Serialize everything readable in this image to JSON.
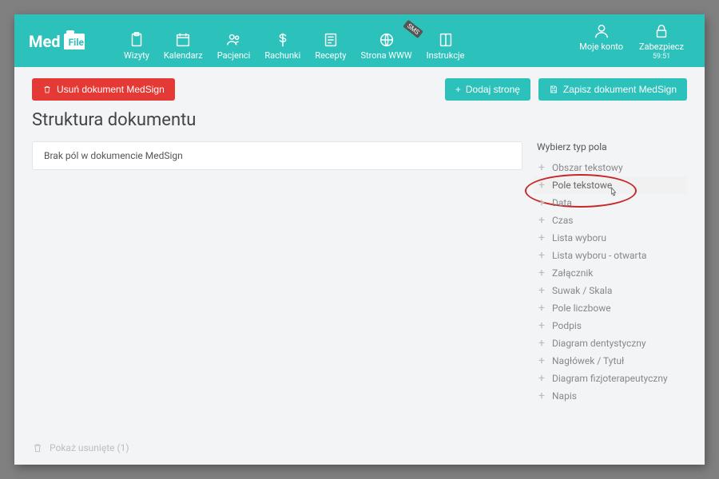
{
  "logo": {
    "part1": "Med",
    "part2": "File"
  },
  "nav": {
    "items": [
      {
        "label": "Wizyty"
      },
      {
        "label": "Kalendarz"
      },
      {
        "label": "Pacjenci"
      },
      {
        "label": "Rachunki"
      },
      {
        "label": "Recepty"
      },
      {
        "label": "Strona WWW",
        "badge": "SMS"
      },
      {
        "label": "Instrukcje"
      }
    ],
    "right": [
      {
        "label": "Moje konto"
      },
      {
        "label": "Zabezpiecz",
        "sub": "59:51"
      }
    ]
  },
  "actions": {
    "delete": "Usuń dokument MedSign",
    "add_page": "Dodaj stronę",
    "save": "Zapisz dokument MedSign"
  },
  "page_title": "Struktura dokumentu",
  "empty_msg": "Brak pól w dokumencie MedSign",
  "sidebar": {
    "title": "Wybierz typ pola",
    "items": [
      "Obszar tekstowy",
      "Pole tekstowe",
      "Data",
      "Czas",
      "Lista wyboru",
      "Lista wyboru - otwarta",
      "Załącznik",
      "Suwak / Skala",
      "Pole liczbowe",
      "Podpis",
      "Diagram dentystyczny",
      "Nagłówek / Tytuł",
      "Diagram fizjoterapeutyczny",
      "Napis"
    ],
    "hovered_index": 1,
    "circled_index": 1
  },
  "footer": {
    "show_deleted": "Pokaż usunięte (1)"
  }
}
